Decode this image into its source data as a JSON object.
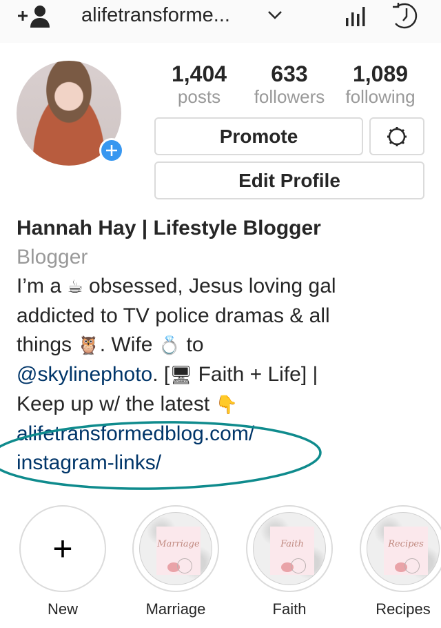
{
  "header": {
    "username": "alifetransforme...",
    "icons": [
      "add-user-icon",
      "chevron-down-icon",
      "insights-icon",
      "archive-history-icon"
    ]
  },
  "profile": {
    "stats": [
      {
        "value": "1,404",
        "label": "posts"
      },
      {
        "value": "633",
        "label": "followers"
      },
      {
        "value": "1,089",
        "label": "following"
      }
    ],
    "buttons": {
      "promote": "Promote",
      "edit_profile": "Edit Profile"
    },
    "name": "Hannah Hay | Lifestyle Blogger",
    "category": "Blogger",
    "bio": {
      "line1_a": "I’m a ",
      "emoji_coffee": "☕",
      "line1_b": " obsessed, Jesus loving gal",
      "line2": "addicted to TV police dramas & all",
      "line3_a": "things ",
      "emoji_owl": "🦉",
      "line3_b": ". Wife ",
      "emoji_ring": "💍",
      "line3_c": " to",
      "mention": "@skylinephoto",
      "line4_a": ". [",
      "emoji_computer": "🖥",
      "line4_b": " Faith + Life] |",
      "line5": "Keep up w/ the latest ",
      "emoji_point": "👇",
      "link_1": "alifetransformedblog.com/",
      "link_2": "instagram-links/"
    },
    "annotation_color": "#0f8b8d",
    "link_color": "#003569"
  },
  "highlights": [
    {
      "label": "New",
      "cover_text": ""
    },
    {
      "label": "Marriage",
      "cover_text": "Marriage"
    },
    {
      "label": "Faith",
      "cover_text": "Faith"
    },
    {
      "label": "Recipes",
      "cover_text": "Recipes"
    }
  ]
}
